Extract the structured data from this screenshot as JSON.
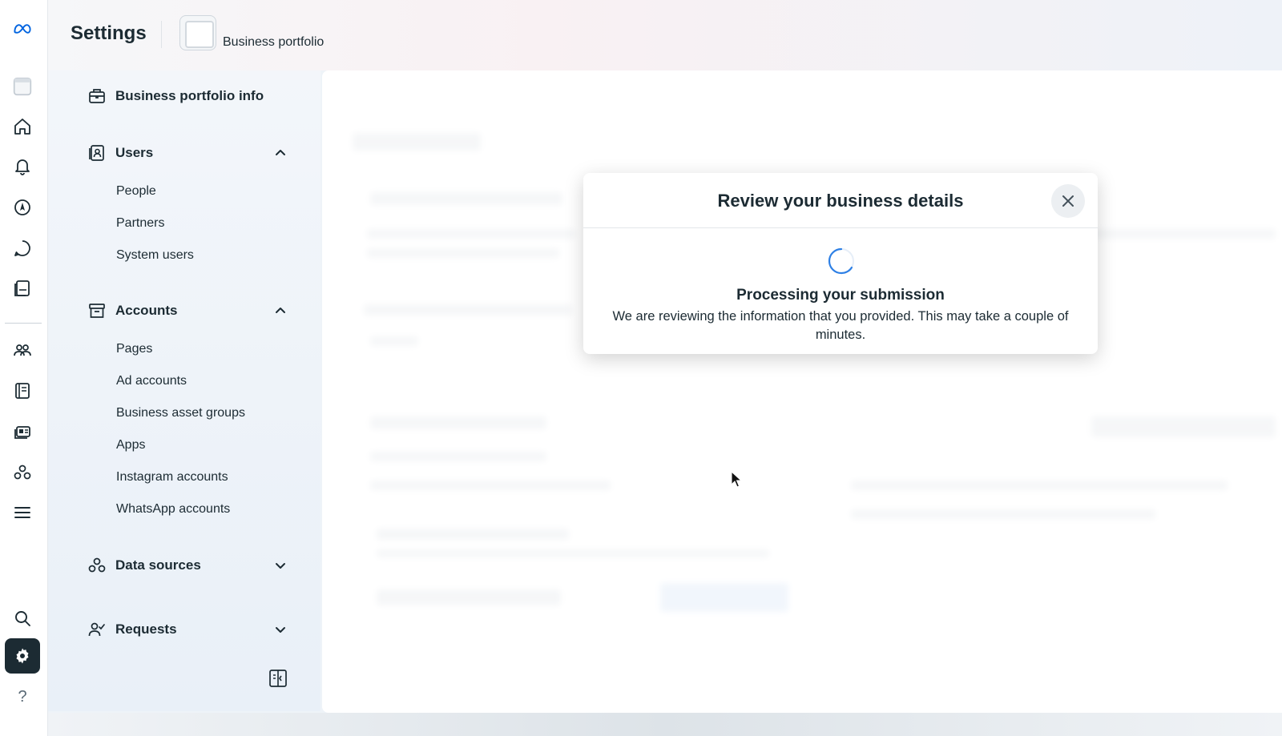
{
  "header": {
    "title": "Settings",
    "portfolio_name": "Business portfolio"
  },
  "rail": {
    "items": [
      {
        "icon": "meta-logo-icon"
      },
      {
        "icon": "portfolio-thumb-icon"
      },
      {
        "icon": "home-icon"
      },
      {
        "icon": "bell-icon"
      },
      {
        "icon": "compass-icon"
      },
      {
        "icon": "chat-icon"
      },
      {
        "icon": "pages-icon"
      },
      {
        "icon": "people-group-icon"
      },
      {
        "icon": "book-icon"
      },
      {
        "icon": "ads-icon"
      },
      {
        "icon": "data-sources-icon"
      },
      {
        "icon": "menu-icon"
      },
      {
        "icon": "search-icon"
      },
      {
        "icon": "gear-icon"
      },
      {
        "icon": "help-icon"
      }
    ],
    "help_label": "?"
  },
  "nav": {
    "business_info": {
      "label": "Business portfolio info",
      "icon": "briefcase-icon"
    },
    "users": {
      "label": "Users",
      "icon": "user-badge-icon",
      "expanded": true,
      "items": [
        "People",
        "Partners",
        "System users"
      ]
    },
    "accounts": {
      "label": "Accounts",
      "icon": "archive-box-icon",
      "expanded": true,
      "items": [
        "Pages",
        "Ad accounts",
        "Business asset groups",
        "Apps",
        "Instagram accounts",
        "WhatsApp accounts"
      ]
    },
    "data_sources": {
      "label": "Data sources",
      "icon": "data-sources-icon",
      "expanded": false
    },
    "requests": {
      "label": "Requests",
      "icon": "user-check-icon",
      "expanded": false
    }
  },
  "modal": {
    "title": "Review your business details",
    "heading": "Processing your submission",
    "body": "We are reviewing the information that you provided. This may take a couple of minutes."
  },
  "colors": {
    "accent": "#0064e0",
    "text": "#1c2b33",
    "active_rail": "#1c2b33"
  }
}
